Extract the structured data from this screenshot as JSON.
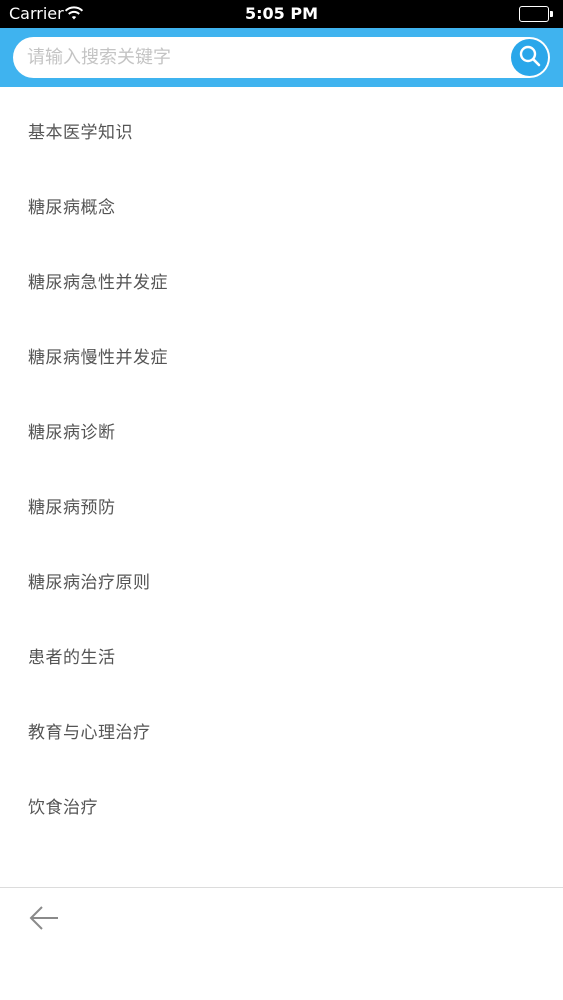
{
  "status_bar": {
    "carrier": "Carrier",
    "time": "5:05 PM",
    "wifi_icon": "wifi-icon",
    "battery_icon": "battery-icon"
  },
  "search": {
    "placeholder": "请输入搜索关键字",
    "value": "",
    "button_icon": "search-icon",
    "header_color": "#3fb3ef"
  },
  "topics": [
    {
      "label": "基本医学知识"
    },
    {
      "label": "糖尿病概念"
    },
    {
      "label": "糖尿病急性并发症"
    },
    {
      "label": "糖尿病慢性并发症"
    },
    {
      "label": "糖尿病诊断"
    },
    {
      "label": "糖尿病预防"
    },
    {
      "label": "糖尿病治疗原则"
    },
    {
      "label": "患者的生活"
    },
    {
      "label": "教育与心理治疗"
    },
    {
      "label": "饮食治疗"
    }
  ],
  "bottom_bar": {
    "back_icon": "arrow-left-icon"
  }
}
